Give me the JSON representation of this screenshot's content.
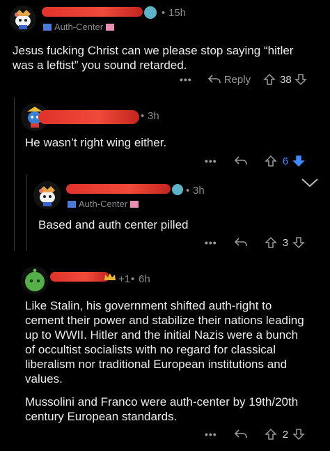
{
  "comments": [
    {
      "time": "15h",
      "flair": "Auth-Center",
      "body": [
        "Jesus fucking Christ can we please stop saying “hitler",
        "was a leftist” you sound retarded."
      ],
      "reply_label": "Reply",
      "votes": "38"
    },
    {
      "time": "3h",
      "body": [
        "He wasn’t right wing either."
      ],
      "votes": "6",
      "upvote_color": "#3d8bff"
    },
    {
      "time": "3h",
      "flair": "Auth-Center",
      "body": [
        "Based and auth center pilled"
      ],
      "votes": "3"
    },
    {
      "time": "6h",
      "award_count": "+1",
      "body": [
        "Like Stalin, his government shifted auth-right to",
        "cement their power and stabilize their nations leading",
        "up to WWII. Hitler and the initial Nazis were a bunch",
        "of occultist socialists with no regard for classical",
        "liberalism nor traditional European institutions and",
        "values.",
        "",
        "Mussolini and Franco were auth-center by 19th/20th",
        "century European standards."
      ],
      "votes": "2"
    }
  ],
  "separator": "•",
  "more_label": "•••"
}
